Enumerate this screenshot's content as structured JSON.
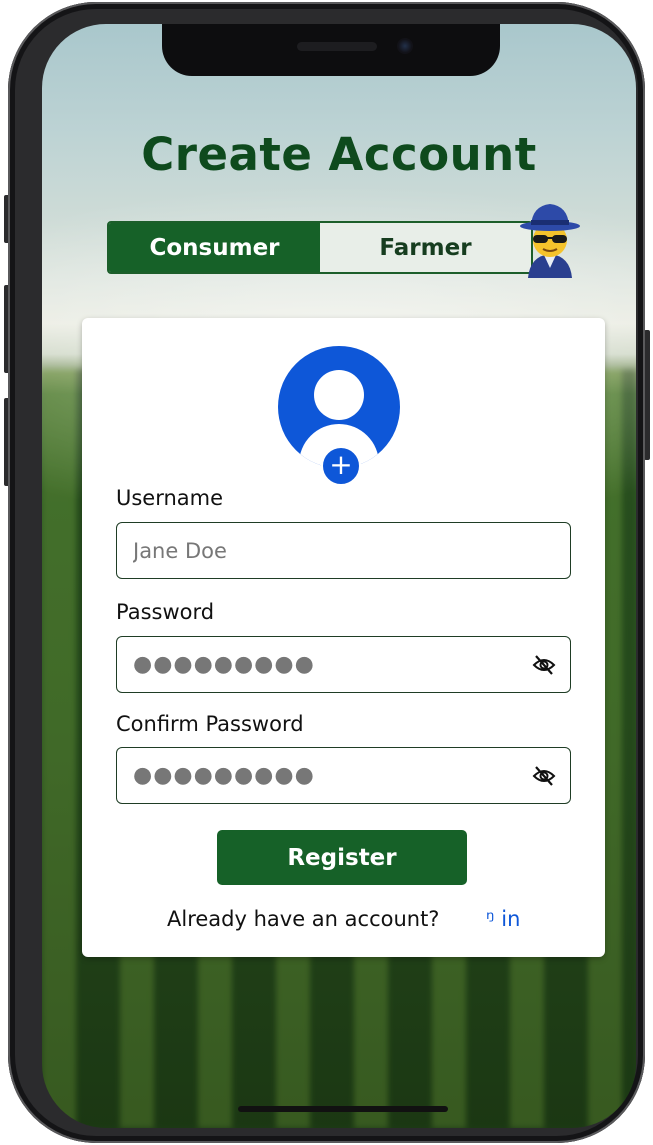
{
  "header": {
    "title": "Create Account"
  },
  "role_toggle": {
    "options": [
      "Consumer",
      "Farmer"
    ],
    "selected": "Consumer",
    "active_color": "#166128"
  },
  "decor": {
    "emoji": "detective-emoji-icon"
  },
  "profile": {
    "avatar_icon": "user-avatar-icon",
    "add_icon": "plus-icon",
    "add_symbol": "+",
    "accent_color": "#0e57d8"
  },
  "form": {
    "username": {
      "label": "Username",
      "placeholder": "Jane Doe"
    },
    "password": {
      "label": "Password",
      "masked_value": "●●●●●●●●●",
      "toggle_icon": "eye-off-icon"
    },
    "confirm_password": {
      "label": "Confirm Password",
      "masked_value": "●●●●●●●●●",
      "toggle_icon": "eye-off-icon"
    },
    "submit_label": "Register"
  },
  "footer": {
    "prompt": "Already have an account?",
    "link_text": "ᵑ in"
  }
}
